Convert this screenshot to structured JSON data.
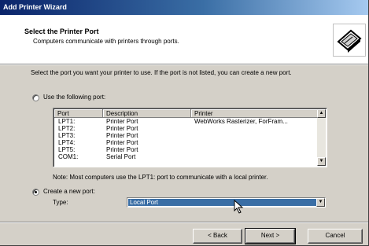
{
  "window": {
    "title": "Add Printer Wizard"
  },
  "header": {
    "title": "Select the Printer Port",
    "subtitle": "Computers communicate with printers through ports."
  },
  "intro_text": "Select the port you want your printer to use.  If the port is not listed, you can create a new port.",
  "use_existing": {
    "label": "Use the following port:",
    "checked": false
  },
  "port_list": {
    "columns": [
      "Port",
      "Description",
      "Printer"
    ],
    "rows": [
      {
        "port": "LPT1:",
        "description": "Printer Port",
        "printer": "WebWorks Rasterizer, ForFram..."
      },
      {
        "port": "LPT2:",
        "description": "Printer Port",
        "printer": ""
      },
      {
        "port": "LPT3:",
        "description": "Printer Port",
        "printer": ""
      },
      {
        "port": "LPT4:",
        "description": "Printer Port",
        "printer": ""
      },
      {
        "port": "LPT5:",
        "description": "Printer Port",
        "printer": ""
      },
      {
        "port": "COM1:",
        "description": "Serial Port",
        "printer": ""
      }
    ]
  },
  "note": "Note: Most computers use the LPT1: port to communicate with a local printer.",
  "create_new": {
    "label": "Create a new port:",
    "checked": true
  },
  "type": {
    "label": "Type:",
    "selected": "Local Port"
  },
  "buttons": {
    "back": "< Back",
    "next": "Next >",
    "cancel": "Cancel"
  },
  "colors": {
    "title_bar": "#0a246a",
    "selection": "#3a6ea5",
    "face": "#d4d0c8"
  }
}
